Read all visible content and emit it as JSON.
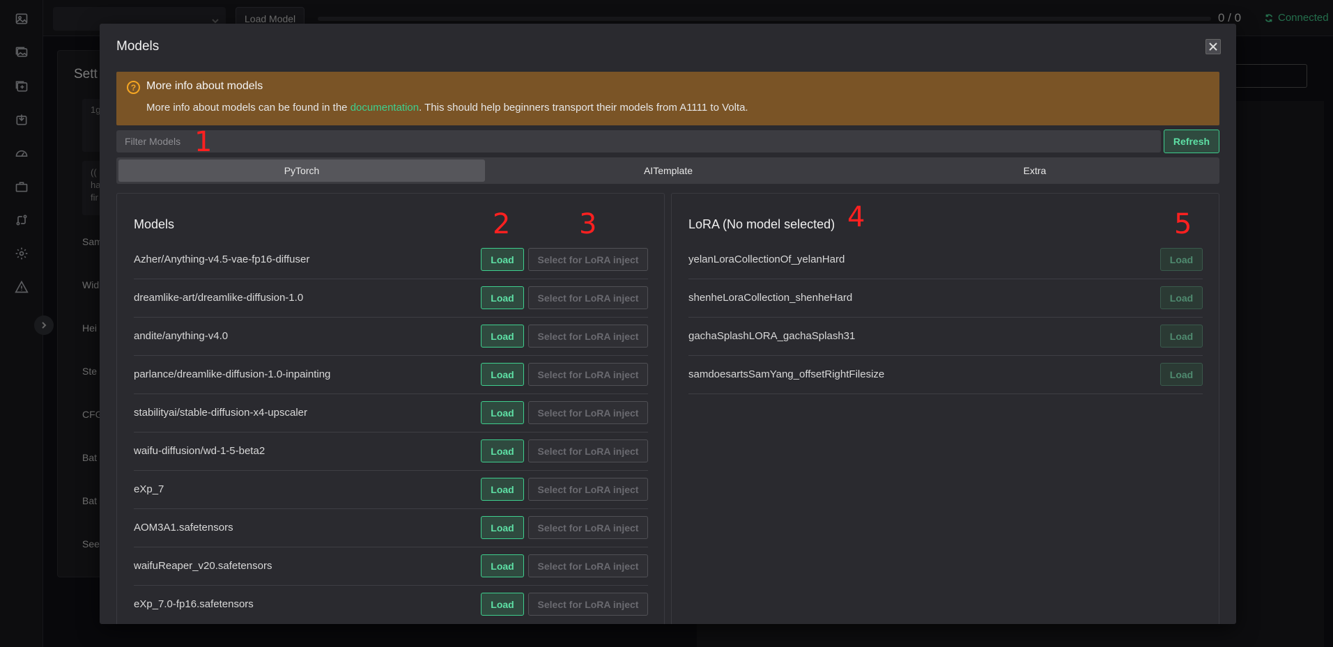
{
  "topbar": {
    "load_model_label": "Load Model",
    "progress_text": "0 / 0",
    "status_text": "Connected",
    "progress_value": 0
  },
  "rail_icons": [
    "image-icon",
    "images-icon",
    "add-image-icon",
    "download-icon",
    "gauge-icon",
    "briefcase-icon",
    "git-compare-icon",
    "gear-icon",
    "warning-icon"
  ],
  "background": {
    "heading": "Sett",
    "labels": [
      "Sam",
      "Wid",
      "Hei",
      "Ste",
      "CFG",
      "Bat",
      "Bat",
      "See"
    ],
    "prompt_box1": "1g",
    "prompt_box2_lines": [
      "((",
      "ha",
      "fir"
    ]
  },
  "modal": {
    "title": "Models",
    "alert": {
      "title": "More info about models",
      "body_before": "More info about models can be found in the ",
      "body_link": "documentation",
      "body_after": ". This should help beginners transport their models from A1111 to Volta."
    },
    "filter_placeholder": "Filter Models",
    "refresh_label": "Refresh",
    "tabs": [
      "PyTorch",
      "AITemplate",
      "Extra"
    ],
    "active_tab": "PyTorch",
    "models_title": "Models",
    "load_label": "Load",
    "inject_label": "Select for LoRA inject",
    "models": [
      "Azher/Anything-v4.5-vae-fp16-diffuser",
      "dreamlike-art/dreamlike-diffusion-1.0",
      "andite/anything-v4.0",
      "parlance/dreamlike-diffusion-1.0-inpainting",
      "stabilityai/stable-diffusion-x4-upscaler",
      "waifu-diffusion/wd-1-5-beta2",
      "eXp_7",
      "AOM3A1.safetensors",
      "waifuReaper_v20.safetensors",
      "eXp_7.0-fp16.safetensors"
    ],
    "lora_title": "LoRA (No model selected)",
    "loras": [
      "yelanLoraCollectionOf_yelanHard",
      "shenheLoraCollection_shenheHard",
      "gachaSplashLORA_gachaSplash31",
      "samdoesartsSamYang_offsetRightFilesize"
    ]
  },
  "annotations": [
    "1",
    "2",
    "3",
    "4",
    "5"
  ],
  "colors": {
    "accent": "#3ecf8e",
    "alert_bg": "#7a5426",
    "alert_icon": "#f5a623",
    "annotation": "#ff2020"
  }
}
